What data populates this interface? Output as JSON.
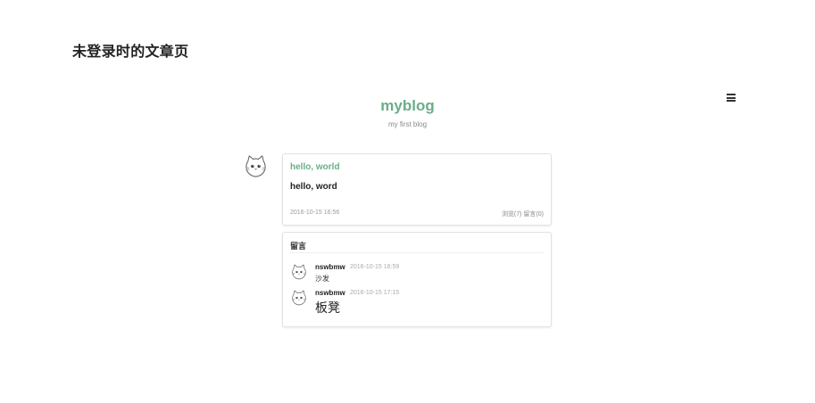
{
  "page": {
    "heading": "未登录时的文章页"
  },
  "site": {
    "title": "myblog",
    "subtitle": "my first blog",
    "menu_icon": "hamburger-menu-icon"
  },
  "post": {
    "title": "hello, world",
    "body": "hello, word",
    "date": "2016-10-15 16:56",
    "stats": "浏览(7) 留言(0)"
  },
  "comments": {
    "header": "留言",
    "items": [
      {
        "author": "nswbmw",
        "time": "2016-10-15 16:59",
        "text": "沙发"
      },
      {
        "author": "nswbmw",
        "time": "2016-10-15 17:15",
        "text": "板凳"
      }
    ]
  },
  "colors": {
    "accent": "#6aae88"
  }
}
